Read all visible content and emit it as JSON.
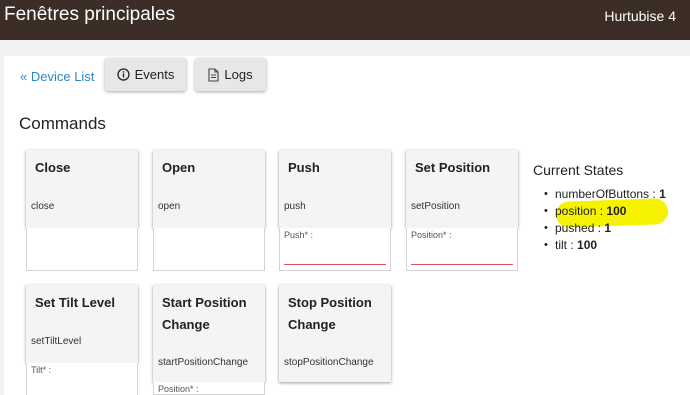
{
  "header": {
    "title": "Fenêtres principales",
    "hub": "Hurtubise 4"
  },
  "nav": {
    "device_list": "« Device List",
    "events": "Events",
    "logs": "Logs"
  },
  "commands_title": "Commands",
  "commands": [
    {
      "name": "Close",
      "method": "close",
      "param": ""
    },
    {
      "name": "Open",
      "method": "open",
      "param": ""
    },
    {
      "name": "Push",
      "method": "push",
      "param": "Push* :"
    },
    {
      "name": "Set Position",
      "method": "setPosition",
      "param": "Position* :"
    },
    {
      "name": "Set Tilt Level",
      "method": "setTiltLevel",
      "param": "Tilt* :"
    },
    {
      "name": "Start Position Change",
      "method": "startPositionChange",
      "param": "Position* :"
    },
    {
      "name": "Stop Position Change",
      "method": "stopPositionChange",
      "param": ""
    }
  ],
  "states": {
    "title": "Current States",
    "items": [
      {
        "name": "numberOfButtons",
        "value": "1"
      },
      {
        "name": "position",
        "value": "100"
      },
      {
        "name": "pushed",
        "value": "1"
      },
      {
        "name": "tilt",
        "value": "100"
      }
    ]
  },
  "colors": {
    "header_bg": "#3c2e26",
    "link": "#2f86c6",
    "highlight": "#f7f200",
    "input_underline": "#e05050"
  },
  "icons": {
    "events": "info-circle-icon",
    "logs": "document-icon"
  }
}
